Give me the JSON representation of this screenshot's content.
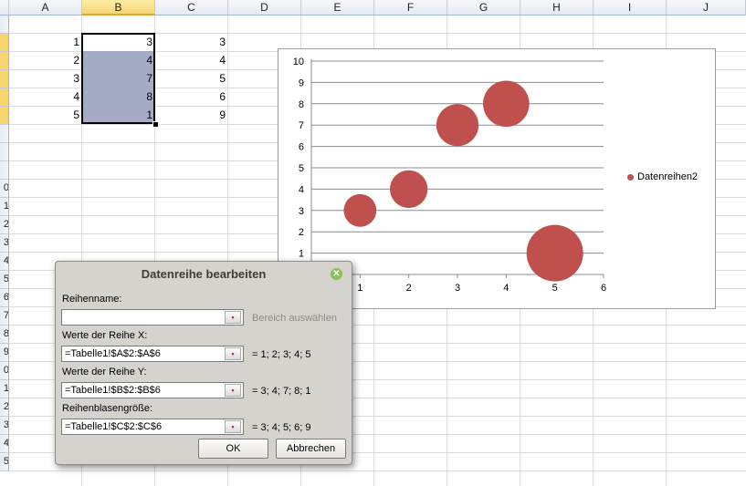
{
  "columns": [
    "A",
    "B",
    "C",
    "D",
    "E",
    "F",
    "G",
    "H",
    "I",
    "J"
  ],
  "rows": [
    "",
    "",
    "",
    "",
    "",
    "",
    "",
    "",
    "",
    "0",
    "1",
    "2",
    "3",
    "4",
    "5",
    "6",
    "7",
    "8",
    "9",
    "0",
    "1",
    "2",
    "3",
    "4",
    "5"
  ],
  "cells": {
    "A": [
      "1",
      "2",
      "3",
      "4",
      "5"
    ],
    "B": [
      "3",
      "4",
      "7",
      "8",
      "1"
    ],
    "C": [
      "3",
      "4",
      "5",
      "6",
      "9"
    ]
  },
  "chart_data": {
    "type": "bubble",
    "x": [
      1,
      2,
      3,
      4,
      5
    ],
    "y": [
      3,
      4,
      7,
      8,
      1
    ],
    "size": [
      3,
      4,
      5,
      6,
      9
    ],
    "series": [
      {
        "name": "Datenreihen2",
        "color": "#c0504d"
      }
    ],
    "xlim": [
      0,
      6
    ],
    "ylim": [
      0,
      10
    ],
    "xticks": [
      "1",
      "2",
      "3",
      "4",
      "5",
      "6"
    ],
    "yticks": [
      "1",
      "2",
      "3",
      "4",
      "5",
      "6",
      "7",
      "8",
      "9",
      "10"
    ],
    "grid": true,
    "legend": "right"
  },
  "dialog": {
    "title": "Datenreihe bearbeiten",
    "name_label": "Reihenname:",
    "name_value": "",
    "name_hint": "Bereich auswählen",
    "x_label": "Werte der Reihe X:",
    "x_value": "=Tabelle1!$A$2:$A$6",
    "x_result": "= 1; 2; 3; 4; 5",
    "y_label": "Werte der Reihe Y:",
    "y_value": "=Tabelle1!$B$2:$B$6",
    "y_result": "= 3; 4; 7; 8; 1",
    "size_label": "Reihenblasengröße:",
    "size_value": "=Tabelle1!$C$2:$C$6",
    "size_result": "= 3; 4; 5; 6; 9",
    "ok": "OK",
    "cancel": "Abbrechen"
  }
}
